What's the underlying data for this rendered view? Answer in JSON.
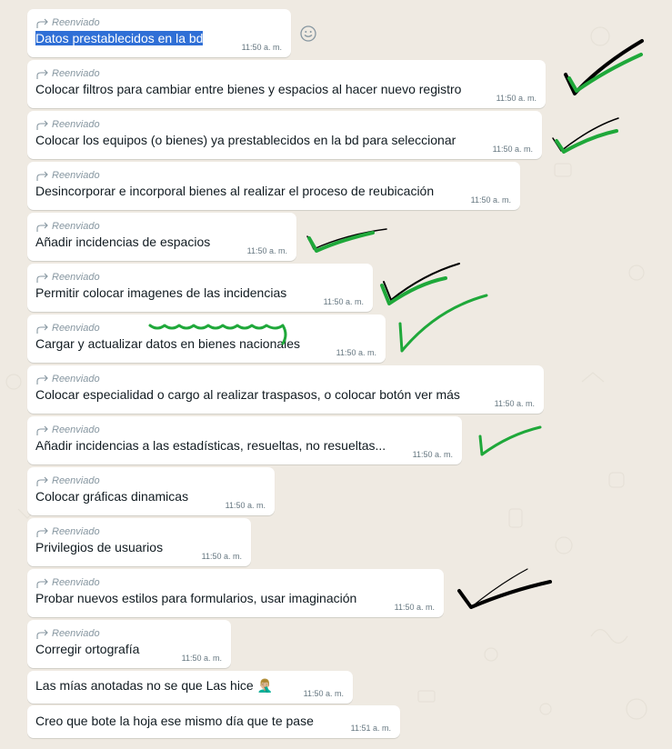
{
  "forward_label": "Reenviado",
  "messages": [
    {
      "text": "Datos prestablecidos en la bd",
      "time": "11:50 a. m."
    },
    {
      "text": "Colocar filtros para cambiar entre bienes y espacios al hacer nuevo registro",
      "time": "11:50 a. m."
    },
    {
      "text": "Colocar los equipos (o bienes) ya prestablecidos en la bd para seleccionar",
      "time": "11:50 a. m."
    },
    {
      "text": "Desincorporar e incorporal bienes al realizar el proceso de reubicación",
      "time": "11:50 a. m."
    },
    {
      "text": "Añadir incidencias de espacios",
      "time": "11:50 a. m."
    },
    {
      "text": "Permitir colocar imagenes de las incidencias",
      "time": "11:50 a. m."
    },
    {
      "text": "Cargar y actualizar datos en bienes nacionales",
      "time": "11:50 a. m."
    },
    {
      "text": "Colocar especialidad o cargo al realizar traspasos, o colocar botón ver más",
      "time": "11:50 a. m."
    },
    {
      "text": "Añadir incidencias a las estadísticas, resueltas, no resueltas...",
      "time": "11:50 a. m."
    },
    {
      "text": "Colocar gráficas dinamicas",
      "time": "11:50 a. m."
    },
    {
      "text": "Privilegios de usuarios",
      "time": "11:50 a. m."
    },
    {
      "text": "Probar nuevos estilos para formularios, usar imaginación",
      "time": "11:50 a. m."
    },
    {
      "text": "Corregir ortografía",
      "time": "11:50 a. m."
    },
    {
      "text": "Las mías anotadas no se que Las hice 🤦🏼‍♂️",
      "time": "11:50 a. m."
    },
    {
      "text": "Creo que bote la hoja ese mismo día que te pase",
      "time": "11:51 a. m."
    }
  ],
  "icons": {
    "forward": "forward-arrow-icon",
    "emoji": "emoji-smiley-icon"
  },
  "colors": {
    "background": "#efeae2",
    "bubble": "#ffffff",
    "green_mark": "#1fa83a",
    "black_mark": "#000000",
    "selection": "#2f6fd6"
  }
}
